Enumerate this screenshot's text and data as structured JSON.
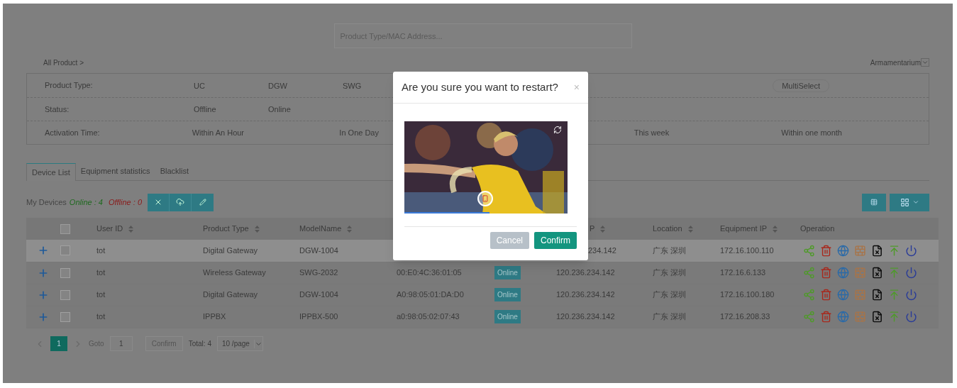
{
  "search": {
    "placeholder": "Product Type/MAC Address..."
  },
  "breadcrumb": {
    "label": "All Product",
    "chevron": ">"
  },
  "category_select": {
    "value": "Armamentarium"
  },
  "filters": [
    {
      "kind": "narrow",
      "label": "Product Type:",
      "options": [
        "UC",
        "DGW",
        "SWG"
      ],
      "action": "MultiSelect"
    },
    {
      "kind": "narrow",
      "label": "Status:",
      "options": [
        "Offline",
        "Online"
      ]
    },
    {
      "kind": "wide",
      "label": "Activation Time:",
      "options": [
        "Within An Hour",
        "In One Day"
      ],
      "options_after_gap": [
        "This week",
        "Within one month"
      ]
    }
  ],
  "tabs": [
    {
      "label": "Device List",
      "selected": true
    },
    {
      "label": "Equipment statistics",
      "selected": false
    },
    {
      "label": "Blacklist",
      "selected": false
    }
  ],
  "summary": {
    "label": "My Devices",
    "online": "Online : 4",
    "offline": "Offline : 0"
  },
  "table": {
    "select_all": {
      "checked": false
    },
    "columns": [
      {
        "label": "User ID"
      },
      {
        "label": "Product Type"
      },
      {
        "label": "ModelName"
      },
      {},
      {},
      {
        "label": "P",
        "clipped": true
      },
      {
        "label": "Location"
      },
      {
        "label": "Equipment IP"
      },
      {
        "label": "Operation",
        "sortable": false
      }
    ],
    "rows": [
      {
        "selected": true,
        "checked": false,
        "user_id": "tot",
        "product_type": "Digital Gateway",
        "model": "DGW-1004",
        "public_ip": "234.142",
        "ip_clipped": true,
        "location": "广东 深圳",
        "equipment_ip": "172.16.100.110"
      },
      {
        "selected": false,
        "checked": false,
        "user_id": "tot",
        "product_type": "Wireless Gateway",
        "model": "SWG-2032",
        "mac": "00:E0:4C:36:01:05",
        "status": "Online",
        "public_ip": "120.236.234.142",
        "location": "广东 深圳",
        "equipment_ip": "172.16.6.133"
      },
      {
        "selected": false,
        "checked": false,
        "user_id": "tot",
        "product_type": "Digital Gateway",
        "model": "DGW-1004",
        "mac": "A0:98:05:01:DA:D0",
        "status": "Online",
        "public_ip": "120.236.234.142",
        "location": "广东 深圳",
        "equipment_ip": "172.16.100.180"
      },
      {
        "selected": false,
        "checked": false,
        "user_id": "tot",
        "product_type": "IPPBX",
        "model": "IPPBX-500",
        "mac": "a0:98:05:02:07:43",
        "status": "Online",
        "public_ip": "120.236.234.142",
        "location": "广东 深圳",
        "equipment_ip": "172.16.208.33"
      }
    ]
  },
  "pagination": {
    "pages": [
      {
        "label": "1",
        "selected": true
      }
    ],
    "goto_label": "Goto",
    "goto_value": "1",
    "confirm": "Confirm",
    "total": "Total: 4",
    "page_size": "10 /page"
  },
  "dialog": {
    "title": "Are you sure you want to restart?",
    "close": "×",
    "buttons": [
      {
        "label": "Cancel",
        "kind": "secondary"
      },
      {
        "label": "Confirm",
        "kind": "primary"
      }
    ]
  }
}
